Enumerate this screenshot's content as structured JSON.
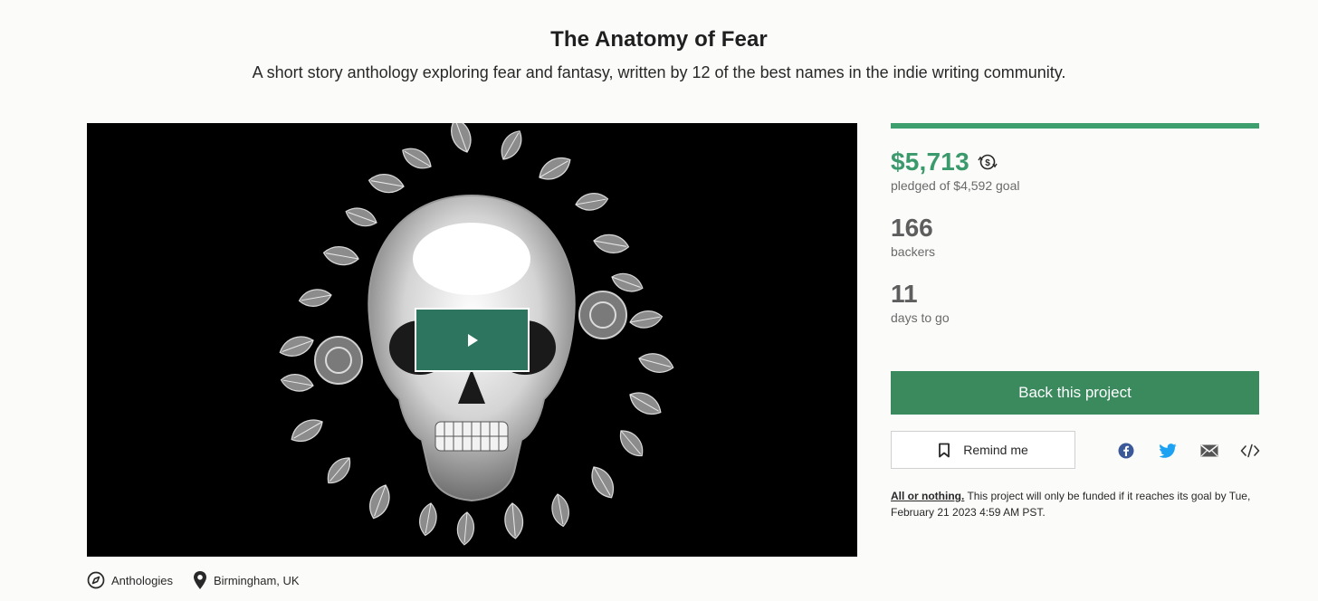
{
  "project": {
    "title": "The Anatomy of Fear",
    "subtitle": "A short story anthology exploring fear and fantasy, written by 12 of the best names in the indie writing community."
  },
  "video": {
    "play_icon": "play-icon"
  },
  "meta": {
    "category": "Anthologies",
    "category_icon": "compass-icon",
    "location": "Birmingham, UK",
    "location_icon": "map-pin-icon"
  },
  "stats": {
    "progress_percent": 100,
    "pledged": "$5,713",
    "pledged_icon": "currency-conversion-icon",
    "pledged_sub": "pledged of $4,592 goal",
    "backers": "166",
    "backers_sub": "backers",
    "days": "11",
    "days_sub": "days to go"
  },
  "actions": {
    "back_label": "Back this project",
    "remind_label": "Remind me",
    "remind_icon": "bookmark-icon",
    "share_icons": [
      "facebook-icon",
      "twitter-icon",
      "email-icon",
      "embed-icon"
    ]
  },
  "note": {
    "link": "All or nothing.",
    "text": " This project will only be funded if it reaches its goal by Tue, February 21 2023 4:59 AM PST."
  },
  "colors": {
    "accent": "#3b9a6c",
    "button": "#3a8a5e",
    "play": "#2e7560",
    "facebook": "#3b5998",
    "twitter": "#1da1f2"
  }
}
